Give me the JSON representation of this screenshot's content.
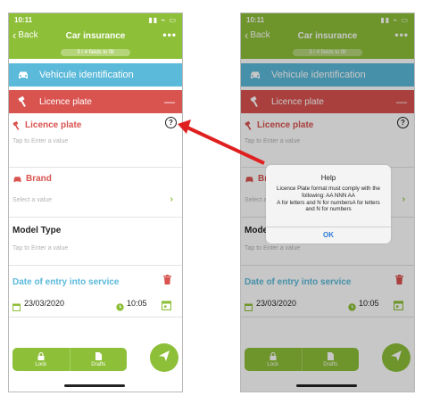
{
  "status": {
    "time": "10:11",
    "icons": "▮▮ ⌁ ▭"
  },
  "nav": {
    "back": "Back",
    "title": "Car insurance",
    "more": "•••"
  },
  "progress": {
    "text": "3 / 4 fields to fill",
    "fraction": 0.75
  },
  "sections": {
    "vehicle": "Vehicule identification",
    "plate": "Licence plate",
    "collapse": "—"
  },
  "fields": {
    "licence": {
      "label": "Licence plate",
      "placeholder": "Tap to Enter a value",
      "help": "?"
    },
    "brand": {
      "label": "Brand",
      "placeholder": "Select a value",
      "chevron": "›"
    },
    "model": {
      "label": "Model Type",
      "placeholder": "Tap to Enter a value"
    },
    "entry": {
      "label": "Date of entry into service",
      "date": "23/03/2020",
      "time": "10:05"
    }
  },
  "bottom": {
    "lock": "Lock",
    "drafts": "Drafts"
  },
  "dialog": {
    "title": "Help",
    "message": "Licence Plate format must comply with the following: AA NNN AA\nA for letters and N for numbersA for letters and N for numbers",
    "ok": "OK"
  },
  "colors": {
    "brand_green": "#8dbf38",
    "section_blue": "#5bb9d9",
    "section_red": "#d9534f",
    "arrow_red": "#e02020"
  },
  "icons": [
    "car-icon",
    "hammer-icon",
    "question-icon",
    "chevron-right-icon",
    "trash-icon",
    "calendar-icon",
    "clock-icon",
    "lock-icon",
    "document-icon",
    "paper-plane-icon",
    "arrow-icon"
  ]
}
